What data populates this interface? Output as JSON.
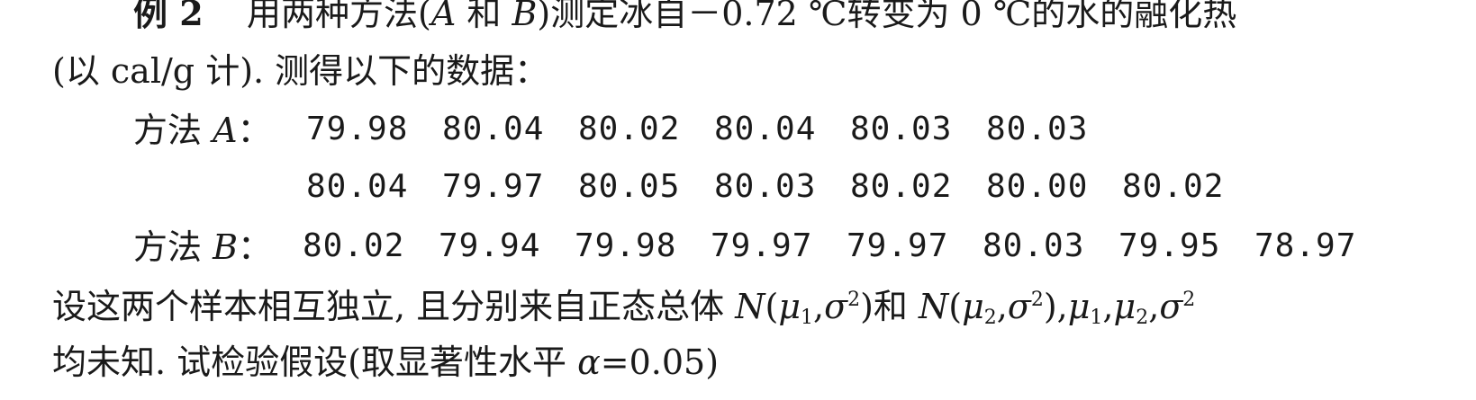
{
  "example": {
    "label": "例 2",
    "title_pre": "用两种方法(",
    "var_a": "A",
    "and": " 和 ",
    "var_b": "B",
    "title_post": ")测定冰自－0.72 ℃转变为 0 ℃的水的融化热",
    "line2": "(以 cal/g 计). 测得以下的数据："
  },
  "methods": [
    {
      "label_pre": "方法 ",
      "label_var": "A",
      "label_post": "：",
      "rows": [
        [
          "79.98",
          "80.04",
          "80.02",
          "80.04",
          "80.03",
          "80.03"
        ],
        [
          "80.04",
          "79.97",
          "80.05",
          "80.03",
          "80.02",
          "80.00",
          "80.02"
        ]
      ]
    },
    {
      "label_pre": "方法 ",
      "label_var": "B",
      "label_post": "：",
      "rows": [
        [
          "80.02",
          "79.94",
          "79.98",
          "79.97",
          "79.97",
          "80.03",
          "79.95",
          "78.97"
        ]
      ]
    }
  ],
  "assumption": {
    "text_pre": "设这两个样本相互独立, 且分别来自正态总体 ",
    "N": "N",
    "mu": "μ",
    "one": "1",
    "two": "2",
    "sigma": "σ",
    "sq": "2",
    "and": ")和 ",
    "line2": "均未知. 试检验假设(取显著性水平 ",
    "alpha": "α",
    "alpha_val": "=0.05)"
  }
}
